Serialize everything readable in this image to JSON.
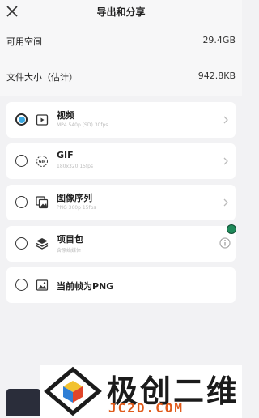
{
  "header": {
    "title": "导出和分享",
    "close_icon": "close-icon"
  },
  "storage": {
    "label": "可用空间",
    "value": "29.4GB"
  },
  "filesize": {
    "label": "文件大小（估计）",
    "value": "942.8KB"
  },
  "options": [
    {
      "name": "视频",
      "sub": "MP4 540p (SD) 30fps",
      "icon": "video-icon",
      "selected": true
    },
    {
      "name": "GIF",
      "sub": "180x320 15fps",
      "icon": "gif-icon",
      "selected": false
    },
    {
      "name": "图像序列",
      "sub": "PNG 360p 15fps",
      "icon": "image-sequence-icon",
      "selected": false
    },
    {
      "name": "项目包",
      "sub": "含原始媒体",
      "icon": "project-package-icon",
      "selected": false
    },
    {
      "name": "当前帧为PNG",
      "sub": "",
      "icon": "image-icon",
      "selected": false
    }
  ],
  "watermark": {
    "brand": "极创二维",
    "domain": "JC2D.COM"
  },
  "colors": {
    "accent": "#3aa7e0",
    "background": "#f2f2f4",
    "card": "#ffffff",
    "watermark_orange": "#e05a1a"
  }
}
